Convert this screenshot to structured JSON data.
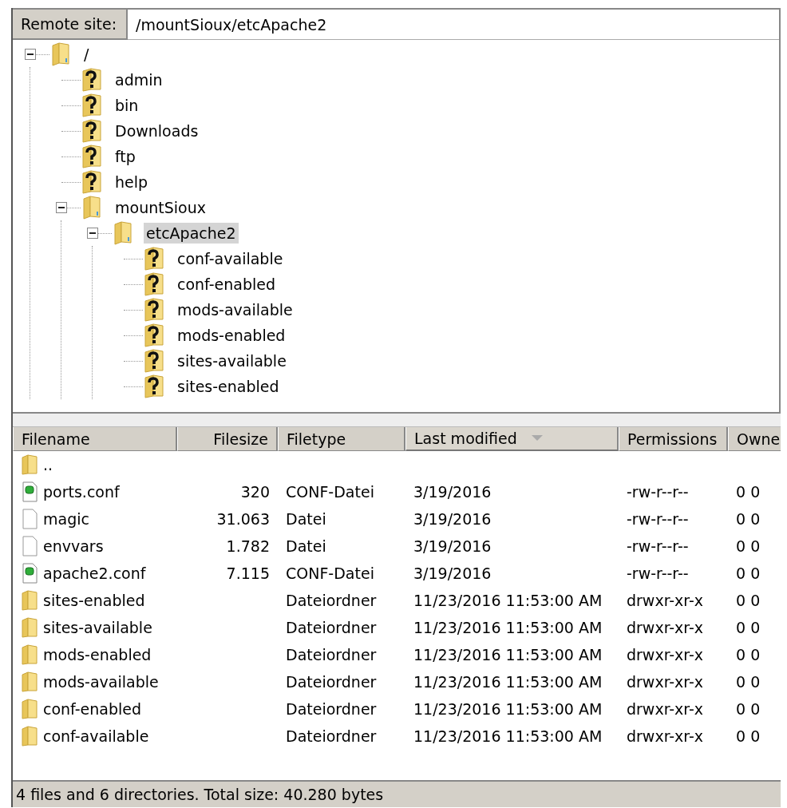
{
  "remote_site": {
    "label": "Remote site:",
    "path": "/mountSioux/etcApache2"
  },
  "tree": [
    {
      "label": "/",
      "kind": "folder",
      "expanded": true,
      "selected": false,
      "children": [
        {
          "label": "admin",
          "kind": "unknown",
          "expanded": false,
          "selected": false
        },
        {
          "label": "bin",
          "kind": "unknown",
          "expanded": false,
          "selected": false
        },
        {
          "label": "Downloads",
          "kind": "unknown",
          "expanded": false,
          "selected": false
        },
        {
          "label": "ftp",
          "kind": "unknown",
          "expanded": false,
          "selected": false
        },
        {
          "label": "help",
          "kind": "unknown",
          "expanded": false,
          "selected": false
        },
        {
          "label": "mountSioux",
          "kind": "folder",
          "expanded": true,
          "selected": false,
          "children": [
            {
              "label": "etcApache2",
              "kind": "folder",
              "expanded": true,
              "selected": true,
              "children": [
                {
                  "label": "conf-available",
                  "kind": "unknown",
                  "expanded": false,
                  "selected": false
                },
                {
                  "label": "conf-enabled",
                  "kind": "unknown",
                  "expanded": false,
                  "selected": false
                },
                {
                  "label": "mods-available",
                  "kind": "unknown",
                  "expanded": false,
                  "selected": false
                },
                {
                  "label": "mods-enabled",
                  "kind": "unknown",
                  "expanded": false,
                  "selected": false
                },
                {
                  "label": "sites-available",
                  "kind": "unknown",
                  "expanded": false,
                  "selected": false
                },
                {
                  "label": "sites-enabled",
                  "kind": "unknown",
                  "expanded": false,
                  "selected": false
                }
              ]
            }
          ]
        }
      ]
    }
  ],
  "table": {
    "columns": [
      {
        "label": "Filename",
        "sorted": false
      },
      {
        "label": "Filesize",
        "sorted": false
      },
      {
        "label": "Filetype",
        "sorted": false
      },
      {
        "label": "Last modified",
        "sorted": true
      },
      {
        "label": "Permissions",
        "sorted": false
      },
      {
        "label": "Owne",
        "sorted": false
      }
    ],
    "rows": [
      {
        "kind": "folder",
        "cells": [
          "..",
          "",
          "",
          "",
          "",
          ""
        ]
      },
      {
        "kind": "conf",
        "cells": [
          "ports.conf",
          "320",
          "CONF-Datei",
          "3/19/2016",
          "-rw-r--r--",
          "0 0"
        ]
      },
      {
        "kind": "file",
        "cells": [
          "magic",
          "31.063",
          "Datei",
          "3/19/2016",
          "-rw-r--r--",
          "0 0"
        ]
      },
      {
        "kind": "file",
        "cells": [
          "envvars",
          "1.782",
          "Datei",
          "3/19/2016",
          "-rw-r--r--",
          "0 0"
        ]
      },
      {
        "kind": "conf",
        "cells": [
          "apache2.conf",
          "7.115",
          "CONF-Datei",
          "3/19/2016",
          "-rw-r--r--",
          "0 0"
        ]
      },
      {
        "kind": "folder",
        "cells": [
          "sites-enabled",
          "",
          "Dateiordner",
          "11/23/2016 11:53:00 AM",
          "drwxr-xr-x",
          "0 0"
        ]
      },
      {
        "kind": "folder",
        "cells": [
          "sites-available",
          "",
          "Dateiordner",
          "11/23/2016 11:53:00 AM",
          "drwxr-xr-x",
          "0 0"
        ]
      },
      {
        "kind": "folder",
        "cells": [
          "mods-enabled",
          "",
          "Dateiordner",
          "11/23/2016 11:53:00 AM",
          "drwxr-xr-x",
          "0 0"
        ]
      },
      {
        "kind": "folder",
        "cells": [
          "mods-available",
          "",
          "Dateiordner",
          "11/23/2016 11:53:00 AM",
          "drwxr-xr-x",
          "0 0"
        ]
      },
      {
        "kind": "folder",
        "cells": [
          "conf-enabled",
          "",
          "Dateiordner",
          "11/23/2016 11:53:00 AM",
          "drwxr-xr-x",
          "0 0"
        ]
      },
      {
        "kind": "folder",
        "cells": [
          "conf-available",
          "",
          "Dateiordner",
          "11/23/2016 11:53:00 AM",
          "drwxr-xr-x",
          "0 0"
        ]
      }
    ]
  },
  "status_bar": "4 files and 6 directories. Total size: 40.280 bytes"
}
